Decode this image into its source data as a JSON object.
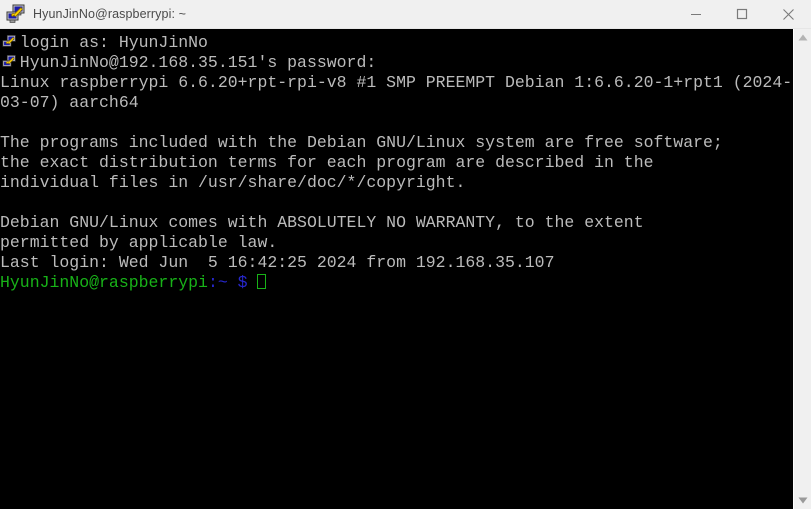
{
  "window": {
    "title": "HyunJinNo@raspberrypi: ~",
    "app_icon": "putty-icon",
    "controls": {
      "minimize": "minimize-button",
      "maximize": "maximize-button",
      "close": "close-button"
    }
  },
  "colors": {
    "titlebar_bg": "#f0f0f0",
    "titlebar_text": "#4a4a4a",
    "terminal_bg": "#000000",
    "terminal_fg": "#bbbbbb",
    "prompt_green": "#18b218",
    "prompt_blue": "#2727cc",
    "scrollbar_bg": "#f0f0f0"
  },
  "terminal": {
    "lines": [
      {
        "id": "line-login-as",
        "text": "  login as: HyunJinNo",
        "icon": "putty-icon"
      },
      {
        "id": "line-password",
        "text": "  HyunJinNo@192.168.35.151's password:",
        "icon": "putty-icon"
      },
      {
        "id": "line-uname-1",
        "text": "Linux raspberrypi 6.6.20+rpt-rpi-v8 #1 SMP PREEMPT Debian 1:6.6.20-1+rpt1 (2024-"
      },
      {
        "id": "line-uname-2",
        "text": "03-07) aarch64"
      },
      {
        "id": "line-blank-1",
        "text": ""
      },
      {
        "id": "line-free-sw",
        "text": "The programs included with the Debian GNU/Linux system are free software;"
      },
      {
        "id": "line-terms",
        "text": "the exact distribution terms for each program are described in the"
      },
      {
        "id": "line-copyright",
        "text": "individual files in /usr/share/doc/*/copyright."
      },
      {
        "id": "line-blank-2",
        "text": ""
      },
      {
        "id": "line-warranty-1",
        "text": "Debian GNU/Linux comes with ABSOLUTELY NO WARRANTY, to the extent"
      },
      {
        "id": "line-warranty-2",
        "text": "permitted by applicable law."
      },
      {
        "id": "line-last-login",
        "text": "Last login: Wed Jun  5 16:42:25 2024 from 192.168.35.107"
      }
    ],
    "prompt": {
      "user_host": "HyunJinNo@raspberrypi",
      "colon": ":",
      "path": "~",
      "sigil": "$",
      "trailing_space": " ",
      "cursor": "block-cursor"
    }
  },
  "scrollbar": {
    "up_arrow": "scroll-up-arrow",
    "down_arrow": "scroll-down-arrow",
    "thumb": "scroll-thumb"
  }
}
